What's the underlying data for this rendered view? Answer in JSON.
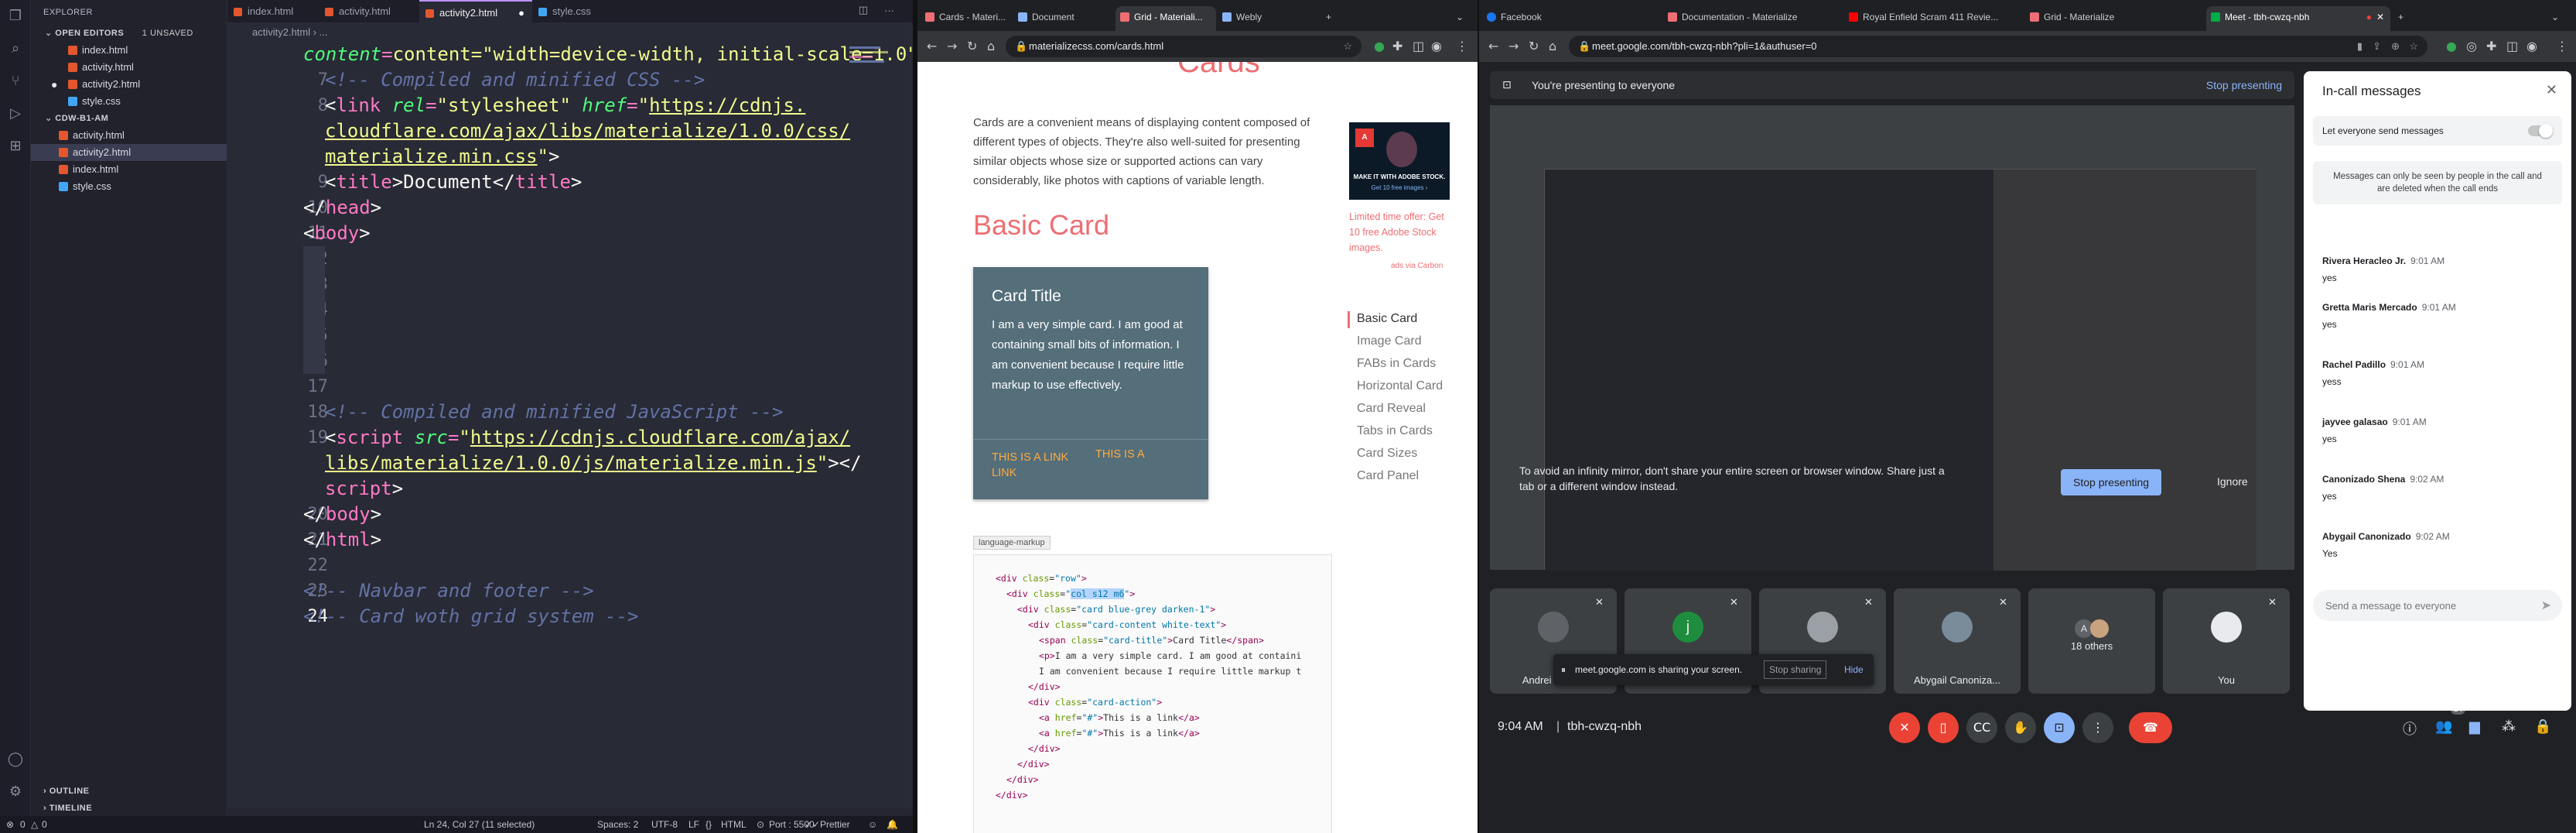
{
  "vscode": {
    "explorer_title": "EXPLORER",
    "open_editors_label": "OPEN EDITORS",
    "unsaved_label": "1 UNSAVED",
    "open_editors": [
      {
        "name": "index.html",
        "type": "html"
      },
      {
        "name": "activity.html",
        "type": "html"
      },
      {
        "name": "activity2.html",
        "type": "html",
        "modified": true
      },
      {
        "name": "style.css",
        "type": "css"
      }
    ],
    "folder_label": "CDW-B1-AM",
    "folder_files": [
      {
        "name": "activity.html",
        "type": "html"
      },
      {
        "name": "activity2.html",
        "type": "html",
        "selected": true
      },
      {
        "name": "index.html",
        "type": "html"
      },
      {
        "name": "style.css",
        "type": "css"
      }
    ],
    "outline_label": "OUTLINE",
    "timeline_label": "TIMELINE",
    "tabs": [
      {
        "name": "index.html",
        "type": "html"
      },
      {
        "name": "activity.html",
        "type": "html"
      },
      {
        "name": "activity2.html",
        "type": "html",
        "active": true
      },
      {
        "name": "style.css",
        "type": "css"
      }
    ],
    "breadcrumb": "activity2.html › ...",
    "code": {
      "l6_tail": "content=\"width=device-width, initial-scale=1.0\">",
      "l7": "<!-- Compiled and minified CSS -->",
      "l8_url_a": "https://cdnjs.",
      "l8_url_b": "cloudflare.com/ajax/libs/materialize/1.0.0/css/",
      "l8_url_c": "materialize.min.css",
      "l9_text": "Document",
      "l18": "<!-- Compiled and minified JavaScript -->",
      "l19_url_a": "https://cdnjs.cloudflare.com/ajax/",
      "l19_url_b": "libs/materialize/1.0.0/js/materialize.min.js",
      "l23": "<!-- Navbar and footer -->",
      "l24": "<!-- Card woth grid system -->"
    },
    "line_numbers": [
      "7",
      "8",
      "",
      "",
      "9",
      "10",
      "11",
      "12",
      "13",
      "14",
      "15",
      "16",
      "17",
      "18",
      "19",
      "",
      "",
      "20",
      "21",
      "22",
      "23",
      "24"
    ],
    "status": {
      "errors": "0",
      "warnings": "0",
      "position": "Ln 24, Col 27 (11 selected)",
      "spaces": "Spaces: 2",
      "encoding": "UTF-8",
      "eol": "LF",
      "language": "HTML",
      "port": "Port : 5500",
      "prettier": "Prettier"
    }
  },
  "browser2": {
    "tabs": [
      {
        "title": "Cards - Materi...",
        "active": false
      },
      {
        "title": "Document",
        "active": false
      },
      {
        "title": "Grid - Materiali...",
        "active": true
      },
      {
        "title": "Webly",
        "active": false
      }
    ],
    "url": "materializecss.com/cards.html",
    "page": {
      "heading": "Cards",
      "intro": "Cards are a convenient means of displaying content composed of different types of objects. They're also well-suited for presenting similar objects whose size or supported actions can vary considerably, like photos with captions of variable length.",
      "section_title": "Basic Card",
      "card_title": "Card Title",
      "card_text": "I am a very simple card. I am good at containing small bits of information. I am convenient because I require little markup to use effectively.",
      "link1": "THIS IS A LINK",
      "link2": "THIS IS A LINK",
      "ad_headline": "MAKE IT WITH ADOBE STOCK.",
      "ad_sub": "Get 10 free images ›",
      "ad_text": "Limited time offer: Get 10 free Adobe Stock images.",
      "ad_via": "ads via Carbon",
      "lang_label": "language-markup",
      "toc": [
        "Basic Card",
        "Image Card",
        "FABs in Cards",
        "Horizontal Card",
        "Card Reveal",
        "Tabs in Cards",
        "Card Sizes",
        "Card Panel"
      ]
    }
  },
  "browser3": {
    "tabs": [
      {
        "title": "Facebook"
      },
      {
        "title": "Documentation - Materialize"
      },
      {
        "title": "Royal Enfield Scram 411 Revie..."
      },
      {
        "title": "Grid - Materialize"
      },
      {
        "title": "Meet - tbh-cwzq-nbh",
        "active": true
      }
    ],
    "url": "meet.google.com/tbh-cwzq-nbh?pli=1&authuser=0",
    "present_text": "You're presenting to everyone",
    "stop_presenting": "Stop presenting",
    "mirror_warning": "To avoid an infinity mirror, don't share your entire screen or browser window. Share just a tab or a different window instead.",
    "stop_presenting_btn": "Stop presenting",
    "ignore_btn": "Ignore",
    "participants": [
      {
        "name": "Andrei Jano...",
        "color": "#5f6368"
      },
      {
        "name": "j",
        "color": "#1e8e3e",
        "initial": "j"
      },
      {
        "name": "",
        "color": "#9aa0a6"
      },
      {
        "name": "Abygail Canoniza...",
        "color": "#7a8b99"
      },
      {
        "name": "18 others",
        "color": "#5f6368",
        "initial": "A"
      },
      {
        "name": "You",
        "color": "#e8eaed"
      }
    ],
    "sharing_notice": "meet.google.com is sharing your screen.",
    "stop_sharing": "Stop sharing",
    "hide": "Hide",
    "time": "9:04 AM",
    "meeting_code": "tbh-cwzq-nbh",
    "people_count": "24",
    "chat": {
      "title": "In-call messages",
      "toggle_label": "Let everyone send messages",
      "notice": "Messages can only be seen by people in the call and are deleted when the call ends",
      "messages": [
        {
          "who": "Rivera Heracleo Jr.",
          "time": "9:01 AM",
          "text": "yes"
        },
        {
          "who": "Gretta Maris Mercado",
          "time": "9:01 AM",
          "text": "yes"
        },
        {
          "who": "Rachel Padillo",
          "time": "9:01 AM",
          "text": "yess"
        },
        {
          "who": "jayvee galasao",
          "time": "9:01 AM",
          "text": "yes"
        },
        {
          "who": "Canonizado Shena",
          "time": "9:02 AM",
          "text": "yes"
        },
        {
          "who": "Abygail Canonizado",
          "time": "9:02 AM",
          "text": "Yes"
        }
      ],
      "input_placeholder": "Send a message to everyone"
    }
  }
}
